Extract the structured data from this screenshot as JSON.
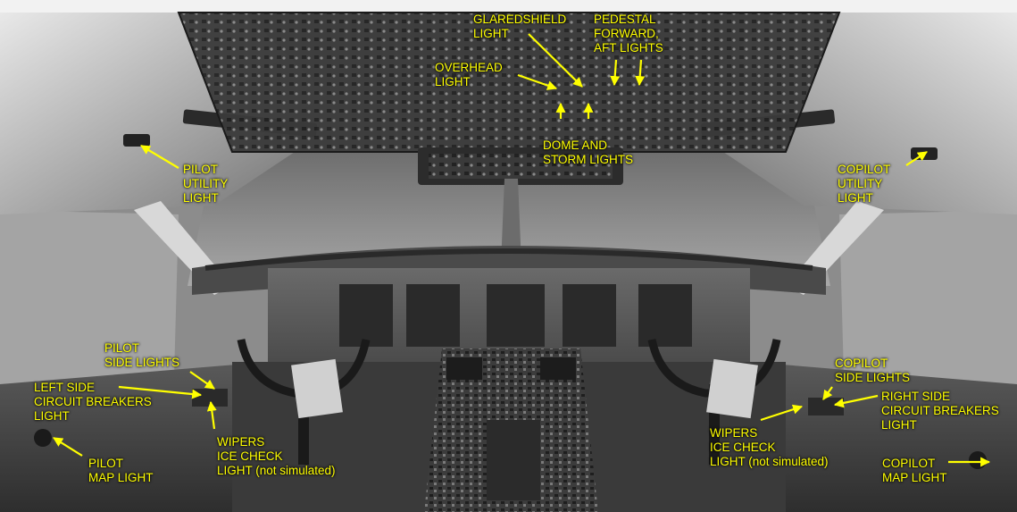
{
  "image": {
    "subject": "cockpit-lighting-diagram",
    "label_color": "#FFFF00",
    "arrow_color": "#FFFF00"
  },
  "labels": {
    "glareshield": "GLAREDSHIELD\nLIGHT",
    "pedestal": "PEDESTAL\nFORWARD,\nAFT LIGHTS",
    "overhead": "OVERHEAD\nLIGHT",
    "dome_storm": "DOME AND\nSTORM LIGHTS",
    "pilot_utility": "PILOT\nUTILITY\nLIGHT",
    "copilot_utility": "COPILOT\nUTILITY\nLIGHT",
    "pilot_side": "PILOT\nSIDE LIGHTS",
    "left_cb": "LEFT SIDE\nCIRCUIT BREAKERS\nLIGHT",
    "wipers_left": "WIPERS\nICE CHECK\nLIGHT (not simulated)",
    "pilot_map": "PILOT\nMAP LIGHT",
    "copilot_side": "COPILOT\nSIDE LIGHTS",
    "right_cb": "RIGHT SIDE\nCIRCUIT BREAKERS\nLIGHT",
    "wipers_right": "WIPERS\nICE CHECK\nLIGHT (not simulated)",
    "copilot_map": "COPILOT\nMAP LIGHT"
  }
}
